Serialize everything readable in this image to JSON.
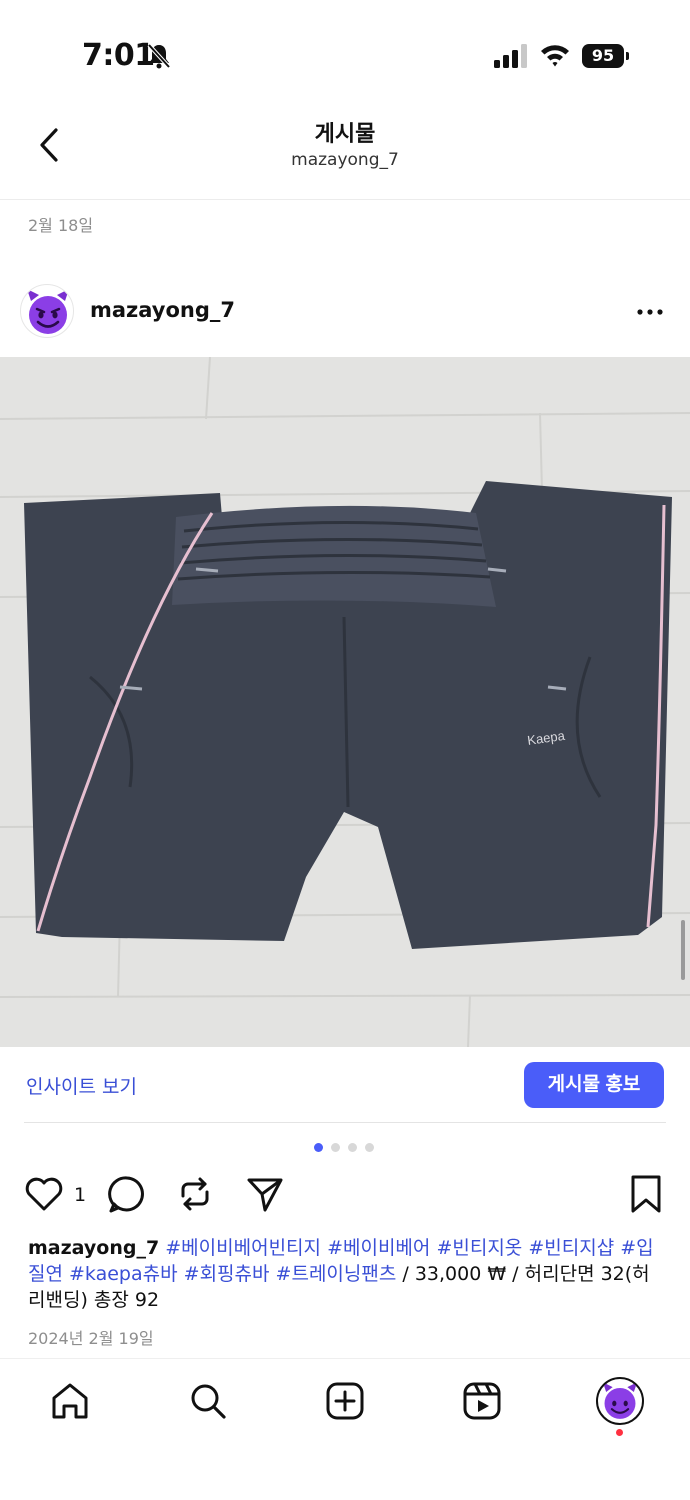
{
  "status_bar": {
    "time": "7:01",
    "battery": "95"
  },
  "header": {
    "title": "게시물",
    "subtitle": "mazayong_7"
  },
  "date_label": "2월 18일",
  "post": {
    "username": "mazayong_7",
    "avatar": "smiling-devil-emoji",
    "image_subject": "pants-photo",
    "brand_label": "Kaepa",
    "insights_label": "인사이트 보기",
    "promote_label": "게시물 홍보",
    "carousel": {
      "count": 4,
      "active": 1
    },
    "like_count": "1",
    "caption": {
      "user": "mazayong_7",
      "tags": [
        "#베이비베어빈티지",
        "#베이비베어",
        "#빈티지옷",
        "#빈티지샵",
        "#입질연",
        "#kaepa츄바",
        "#회핑츄바",
        "#트레이닝팬츠"
      ],
      "text": " / 33,000 ₩ / 허리단면 32(허리밴딩) 총장 92"
    },
    "date": "2024년 2월 19일"
  },
  "colors": {
    "accent": "#4a5df9",
    "link": "#3a4fd6",
    "notification": "#ff3040"
  }
}
